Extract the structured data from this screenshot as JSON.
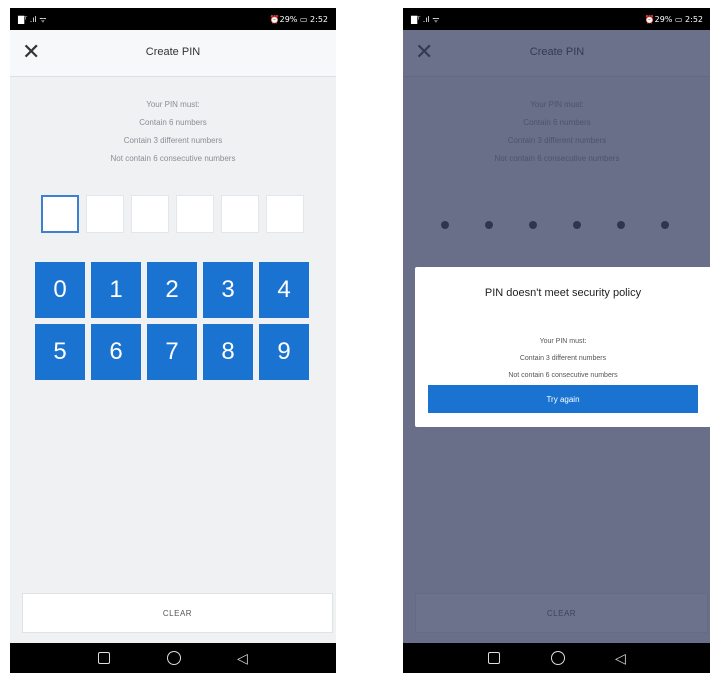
{
  "status_bar": {
    "left": "▇ᵀ .ıl ᯤ",
    "right": "⏰29% ▭ 2:52"
  },
  "header": {
    "title": "Create PIN",
    "close_icon": "close-icon"
  },
  "requirements": {
    "heading": "Your PIN must:",
    "items": [
      "Contain 6 numbers",
      "Contain 3 different numbers",
      "Not contain 6 consecutive numbers"
    ]
  },
  "keypad": {
    "keys": [
      "0",
      "1",
      "2",
      "3",
      "4",
      "5",
      "6",
      "7",
      "8",
      "9"
    ]
  },
  "clear_label": "CLEAR",
  "dialog": {
    "title": "PIN doesn't meet security policy",
    "heading": "Your PIN must:",
    "items": [
      "Contain 3 different numbers",
      "Not contain 6 consecutive numbers"
    ],
    "button": "Try again"
  },
  "nav": {
    "icons": [
      "square-icon",
      "circle-icon",
      "back-triangle-icon"
    ]
  },
  "colors": {
    "accent": "#1a73d1",
    "overlay": "#343c60"
  }
}
